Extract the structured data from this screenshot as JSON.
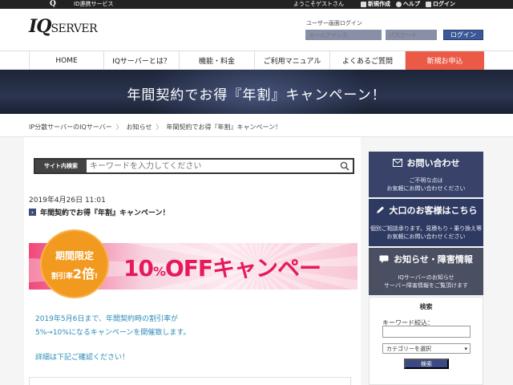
{
  "topbar": {
    "logo": "Q",
    "id_link": "ID連携サービス",
    "welcome": "ようこそゲストさん",
    "links": [
      {
        "label": "新規作成",
        "icon": "document-icon"
      },
      {
        "label": "ヘルプ",
        "icon": "help-icon"
      },
      {
        "label": "ログイン",
        "icon": "login-icon"
      }
    ]
  },
  "header": {
    "logo_iq": "IQ",
    "logo_server": "SERVER",
    "login_label": "ユーザー画面ログイン",
    "email_placeholder": "メールアドレス",
    "password_placeholder": "パスワード",
    "login_button": "ログイン"
  },
  "nav": {
    "items": [
      {
        "label": "HOME"
      },
      {
        "label": "IQサーバーとは？"
      },
      {
        "label": "機能・料金"
      },
      {
        "label": "ご利用マニュアル"
      },
      {
        "label": "よくあるご質問"
      },
      {
        "label": "新規お申込"
      }
    ]
  },
  "hero": {
    "title": "年間契約でお得『年割』キャンペーン！"
  },
  "breadcrumb": {
    "items": [
      "IP分散サーバーのIQサーバー",
      "お知らせ",
      "年間契約でお得『年割』キャンペーン！"
    ],
    "sep": "〉"
  },
  "search": {
    "label": "サイト内検索",
    "placeholder": "キーワードを入力してください"
  },
  "post": {
    "date": "2019年4月26日 11:01",
    "title": "年間契約でお得『年割』キャンペーン！",
    "chev": "›"
  },
  "campaign": {
    "badge_line1": "期間限定",
    "badge_line2_pre": "割引率",
    "badge_line2_num": "2倍",
    "badge_line2_post": "!",
    "big_num": "10",
    "big_pct": "%",
    "big_text": "OFFキャンペーン!!"
  },
  "description": {
    "line1": "2019年5月6日まで、年間契約時の割引率が",
    "line2": "5%→10%になるキャンペーンを開催致します。",
    "line3": "詳細は下記ご確認ください！"
  },
  "sidebar": {
    "contact": {
      "title": "お問い合わせ",
      "sub1": "ご不明な点は",
      "sub2": "お気軽にお問い合わせください"
    },
    "enterprise": {
      "title": "大口のお客様はこちら",
      "sub1": "個別ご相談承ります。見積もり・乗り換え等",
      "sub2": "お気軽にお問い合わせください"
    },
    "news": {
      "title": "お知らせ・障害情報",
      "sub1": "IQサーバーのお知らせ",
      "sub2": "サーバー障害情報をご覧頂けます"
    },
    "search": {
      "heading": "検索",
      "keyword_label": "キーワード絞込：",
      "category_select": "カテゴリーを選択",
      "button": "検索"
    }
  },
  "colors": {
    "nav_apply": "#ea5a47",
    "sidebar_navy": "#39436a",
    "accent_text": "#2a8bb5",
    "campaign_pink": "#e6195a",
    "badge_orange": "#f29a20"
  }
}
